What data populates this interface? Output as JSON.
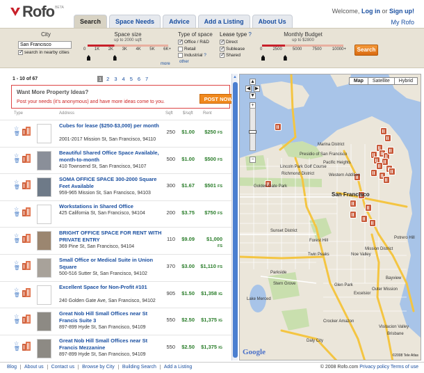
{
  "logo": {
    "word": "Rofo",
    "beta": "BETA"
  },
  "tabs": [
    "Search",
    "Space Needs",
    "Advice",
    "Add a Listing",
    "About Us"
  ],
  "account": {
    "welcome": "Welcome,",
    "login": "Log in",
    "or": "or",
    "signup": "Sign up!",
    "myrofo": "My Rofo"
  },
  "filters": {
    "city_label": "City",
    "city_value": "San Francisco",
    "nearby_label": "search in nearby cities",
    "space_size_label": "Space size",
    "space_size_sub": "up to 2000 sqft",
    "space_size_ticks": [
      "0",
      "1K",
      "2K",
      "3K",
      "4K",
      "5K",
      "6K+"
    ],
    "space_size_value_fraction": 0.333,
    "more": "more",
    "type_label": "Type of space",
    "types": [
      {
        "label": "Office / R&D",
        "checked": true
      },
      {
        "label": "Retail",
        "checked": false
      },
      {
        "label": "Industrial",
        "checked": false
      }
    ],
    "type_help": "?",
    "other": "other",
    "lease_label": "Lease type",
    "lease_help": "?",
    "leases": [
      {
        "label": "Direct",
        "checked": true
      },
      {
        "label": "Sublease",
        "checked": true
      },
      {
        "label": "Shared",
        "checked": true
      }
    ],
    "budget_label": "Monthly Budget",
    "budget_sub": "up to $2800",
    "budget_ticks": [
      "0",
      "2500",
      "5000",
      "7500",
      "10000+"
    ],
    "budget_value_fraction": 0.28,
    "search_button": "Search"
  },
  "results": {
    "count": "1 - 10 of 67",
    "pages": [
      "1",
      "2",
      "3",
      "4",
      "5",
      "6",
      "7"
    ],
    "current_page": "1",
    "ideas_title": "Want More Property Ideas?",
    "ideas_text": "Post your needs (it's anonymous) and have more ideas come to you.",
    "post_button": "POST NOW",
    "columns": {
      "type": "Type",
      "address": "Address",
      "sqft": "Sqft",
      "ppsf": "$/sqft",
      "rent": "Rent"
    },
    "rows": [
      {
        "title": "Cubes for lease ($250-$3,000) per month",
        "address": "2001-2017 Mission St, San Francisco, 94110",
        "sqft": "250",
        "ppsf": "$1.00",
        "rent": "$250",
        "src": "FS",
        "thumb": "#ffffff"
      },
      {
        "title": "Beautiful Shared Office Space Available, month-to-month",
        "address": "410 Townsend St, San Francisco, 94107",
        "sqft": "500",
        "ppsf": "$1.00",
        "rent": "$500",
        "src": "FS",
        "thumb": "#8a8f99"
      },
      {
        "title": "SOMA OFFICE SPACE 300-2000 Square Feet Available",
        "address": "959-965 Mission St, San Francisco, 94103",
        "sqft": "300",
        "ppsf": "$1.67",
        "rent": "$501",
        "src": "FS",
        "thumb": "#6e7a88"
      },
      {
        "title": "Workstations in Shared Office",
        "address": "425 California St, San Francisco, 94104",
        "sqft": "200",
        "ppsf": "$3.75",
        "rent": "$750",
        "src": "FS",
        "thumb": "#ffffff"
      },
      {
        "title": "BRIGHT OFFICE SPACE FOR RENT WITH PRIVATE ENTRY",
        "address": "369 Pine St, San Francisco, 94104",
        "sqft": "110",
        "ppsf": "$9.09",
        "rent": "$1,000",
        "src": "FS",
        "thumb": "#9b8670"
      },
      {
        "title": "Small Office or Medical Suite in Union Square",
        "address": "500-516 Sutter St, San Francisco, 94102",
        "sqft": "370",
        "ppsf": "$3.00",
        "rent": "$1,110",
        "src": "FS",
        "thumb": "#a8a29a"
      },
      {
        "title": "Excellent Space for Non-Profit #101",
        "address": "240 Golden Gate Ave, San Francisco, 94102",
        "sqft": "905",
        "ppsf": "$1.50",
        "rent": "$1,358",
        "src": "IG",
        "thumb": "#ffffff"
      },
      {
        "title": "Great Nob Hill Small Offices near St Francis Suite 3",
        "address": "897-899 Hyde St, San Francisco, 94109",
        "sqft": "550",
        "ppsf": "$2.50",
        "rent": "$1,375",
        "src": "IG",
        "thumb": "#8d8a84"
      },
      {
        "title": "Great Nob Hill Small Offices near St Francis Mezzanine",
        "address": "897-899 Hyde St, San Francisco, 94109",
        "sqft": "550",
        "ppsf": "$2.50",
        "rent": "$1,375",
        "src": "IG",
        "thumb": "#8d8a84"
      }
    ]
  },
  "map": {
    "types": [
      "Map",
      "Satellite",
      "Hybrid"
    ],
    "active_type": "Map",
    "labels": [
      "Marina District",
      "Pacific Heights",
      "Western Addition",
      "Richmond District",
      "Lincoln Park Golf Course",
      "Presidio of San Francisco",
      "Sunset District",
      "Forest Hill",
      "Parkside",
      "Noe Valley",
      "Glen Park",
      "Outer Mission",
      "Excelsior",
      "Visitacion Valley",
      "Bayview",
      "Twin Peaks",
      "Crocker Amazon",
      "Daly City",
      "Brisbane",
      "Golden Gate Park",
      "San Francisco",
      "Lake Merced",
      "Stern Grove",
      "Mission District",
      "Potrero Hill"
    ],
    "google": "Google",
    "copyright": "©2008 Tele Atlas"
  },
  "footer": {
    "links": [
      "Blog",
      "About us",
      "Contact us",
      "Browse by City",
      "Building Search",
      "Add a Listing"
    ],
    "copyright": "© 2008 Rofo.com",
    "privacy": "Privacy policy",
    "terms": "Terms of use"
  },
  "colors": {
    "accent": "#f0891e",
    "link": "#1a4fa0",
    "price": "#2a7d2a",
    "filter_bg": "#e8e3d6",
    "pin": "#c85a3a",
    "water": "#a8c4e8"
  }
}
